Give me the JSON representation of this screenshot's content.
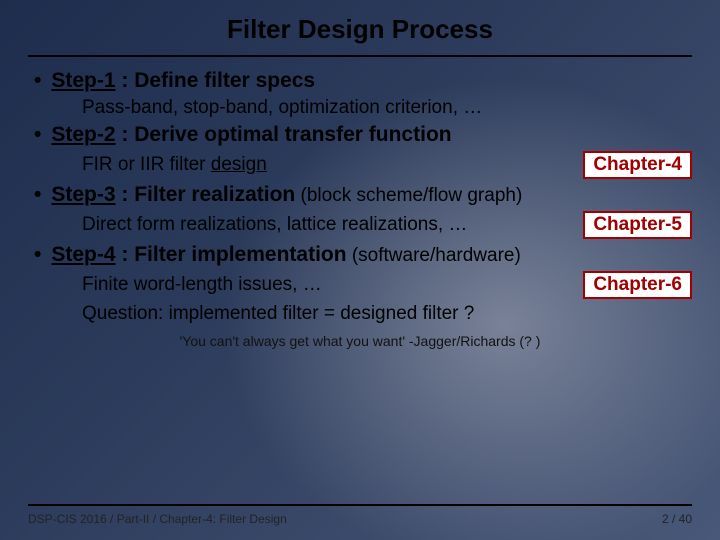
{
  "title": "Filter Design Process",
  "steps": [
    {
      "label": "Step-1",
      "heading_rest": " : Define filter specs",
      "paren": "",
      "subs": [
        {
          "text": "Pass-band, stop-band, optimization criterion, …",
          "chip": ""
        }
      ]
    },
    {
      "label": "Step-2",
      "heading_rest": " : Derive optimal transfer function",
      "paren": "",
      "subs": [
        {
          "text_pre": "FIR or IIR filter ",
          "text_u": "design",
          "text_post": "",
          "chip": "Chapter-4"
        }
      ]
    },
    {
      "label": "Step-3",
      "heading_rest": " : Filter realization",
      "paren": " (block scheme/flow graph)",
      "subs": [
        {
          "text": "Direct form realizations, lattice realizations, …",
          "chip": "Chapter-5"
        }
      ]
    },
    {
      "label": "Step-4",
      "heading_rest": " : Filter implementation",
      "paren": " (software/hardware)",
      "subs": [
        {
          "text": "Finite word-length issues, …",
          "chip": "Chapter-6"
        },
        {
          "text": "Question: implemented filter = designed filter ?",
          "chip": ""
        }
      ]
    }
  ],
  "quote": "'You can't always get what you want' -Jagger/Richards (? )",
  "footer_left": "DSP-CIS 2016 / Part-II / Chapter-4: Filter Design",
  "footer_right": "2 / 40"
}
